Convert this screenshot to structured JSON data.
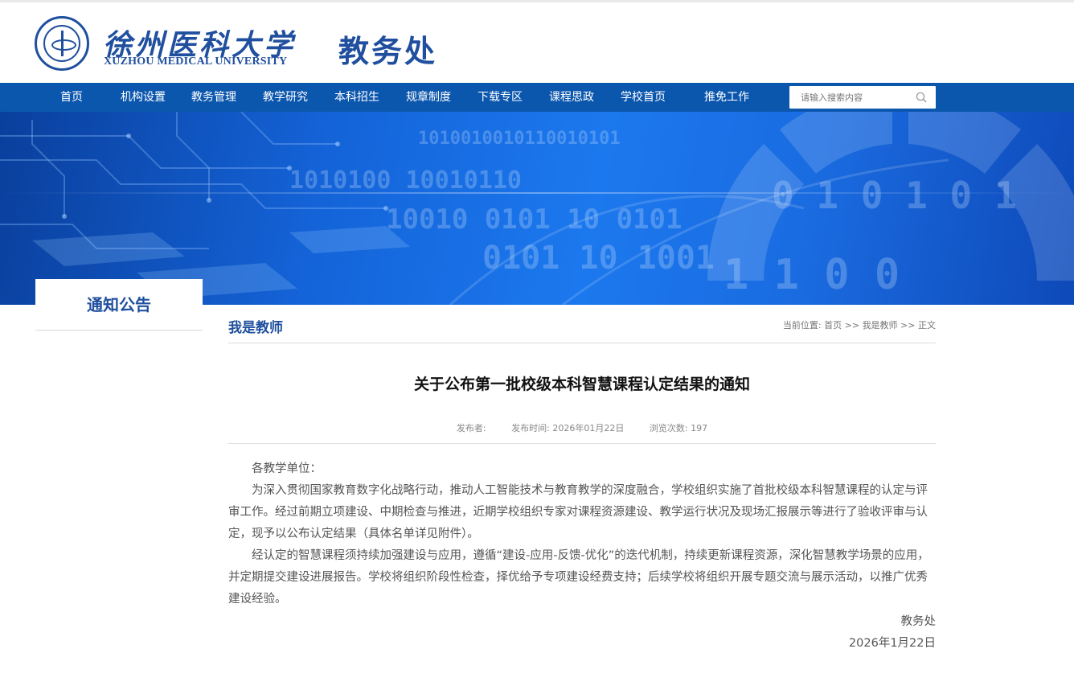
{
  "header": {
    "logo_cn": "徐州医科大学",
    "logo_en": "XUZHOU MEDICAL UNIVERSITY",
    "dept_title": "教务处"
  },
  "nav": {
    "items": [
      {
        "label": "首页"
      },
      {
        "label": "机构设置"
      },
      {
        "label": "教务管理"
      },
      {
        "label": "教学研究"
      },
      {
        "label": "本科招生"
      },
      {
        "label": "规章制度"
      },
      {
        "label": "下载专区"
      },
      {
        "label": "课程思政"
      },
      {
        "label": "学校首页"
      },
      {
        "label": "推免工作"
      }
    ],
    "search_placeholder": "请输入搜索内容"
  },
  "sidebar": {
    "title": "通知公告"
  },
  "content": {
    "section_title": "我是教师",
    "breadcrumb": {
      "prefix": "当前位置: ",
      "items": [
        "首页",
        "我是教师",
        "正文"
      ],
      "separator": " >> "
    },
    "article": {
      "title": "关于公布第一批校级本科智慧课程认定结果的通知",
      "meta": {
        "publisher_label": "发布者:",
        "publish_time_label": "发布时间:",
        "publish_time": "2026年01月22日",
        "views_label": "浏览次数:",
        "views": "197"
      },
      "paragraphs": [
        "各教学单位：",
        "为深入贯彻国家教育数字化战略行动，推动人工智能技术与教育教学的深度融合，学校组织实施了首批校级本科智慧课程的认定与评审工作。经过前期立项建设、中期检查与推进，近期学校组织专家对课程资源建设、教学运行状况及现场汇报展示等进行了验收评审与认定，现予以公布认定结果（具体名单详见附件）。",
        "经认定的智慧课程须持续加强建设与应用，遵循“建设-应用-反馈-优化”的迭代机制，持续更新课程资源，深化智慧教学场景的应用，并定期提交建设进展报告。学校将组织阶段性检查，择优给予专项建设经费支持；后续学校将组织开展专题交流与展示活动，以推广优秀建设经验。"
      ],
      "signature": "教务处",
      "date": "2026年1月22日"
    }
  },
  "colors": {
    "brand_blue": "#1f4f9e",
    "nav_blue": "#0c57ae"
  }
}
